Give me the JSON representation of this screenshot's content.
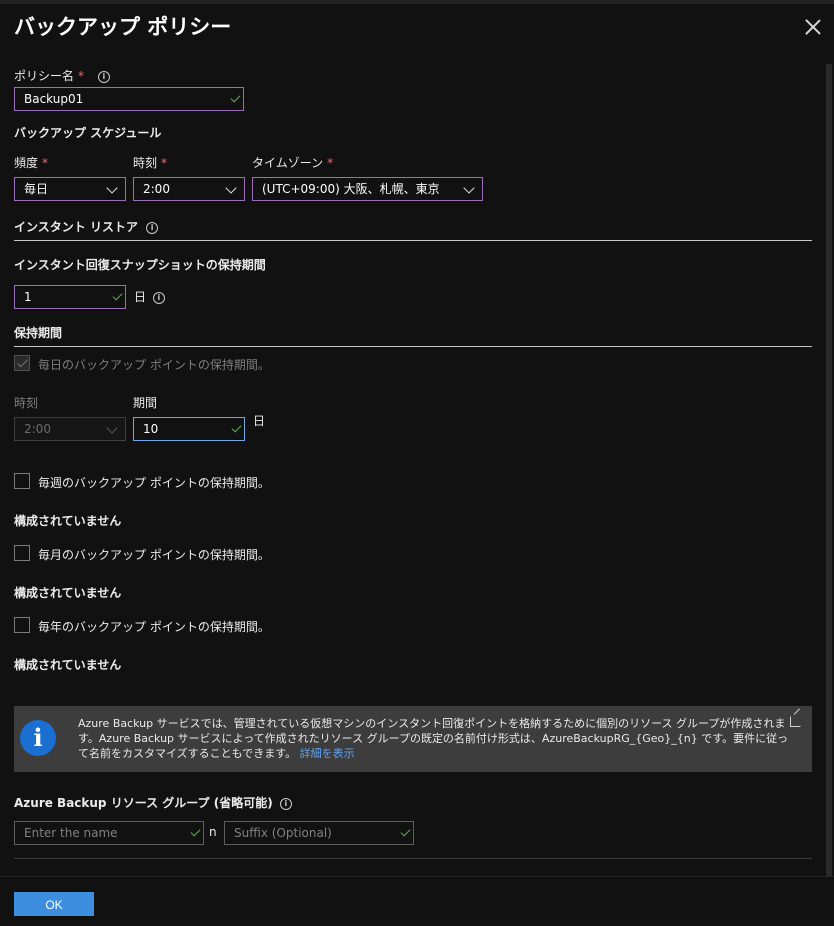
{
  "header": {
    "title": "バックアップ ポリシー"
  },
  "policy_name": {
    "label": "ポリシー名",
    "required": "*",
    "value": "Backup01"
  },
  "schedule": {
    "heading": "バックアップ スケジュール",
    "frequency": {
      "label": "頻度",
      "required": "*",
      "value": "毎日"
    },
    "time": {
      "label": "時刻",
      "required": "*",
      "value": "2:00"
    },
    "timezone": {
      "label": "タイムゾーン",
      "required": "*",
      "value": "(UTC+09:00) 大阪、札幌、東京"
    }
  },
  "instant_restore": {
    "heading": "インスタント リストア",
    "snapshot_label": "インスタント回復スナップショットの保持期間",
    "snapshot_value": "1",
    "unit": "日"
  },
  "retention": {
    "heading": "保持期間",
    "daily": {
      "label": "毎日のバックアップ ポイントの保持期間。",
      "checked": true,
      "time_label": "時刻",
      "time_value": "2:00",
      "duration_label": "期間",
      "duration_value": "10",
      "unit": "日"
    },
    "weekly": {
      "label": "毎週のバックアップ ポイントの保持期間。",
      "checked": false,
      "status": "構成されていません"
    },
    "monthly": {
      "label": "毎月のバックアップ ポイントの保持期間。",
      "checked": false,
      "status": "構成されていません"
    },
    "yearly": {
      "label": "毎年のバックアップ ポイントの保持期間。",
      "checked": false,
      "status": "構成されていません"
    }
  },
  "info_banner": {
    "icon": "info-icon",
    "text": "Azure Backup サービスでは、管理されている仮想マシンのインスタント回復ポイントを格納するために個別のリソース グループが作成されます。Azure Backup サービスによって作成されたリソース グループの既定の名前付け形式は、AzureBackupRG_{Geo}_{n} です。要件に従って名前をカスタマイズすることもできます。",
    "link": "詳細を表示"
  },
  "resource_group": {
    "label": "Azure Backup リソース グループ (省略可能)",
    "name_placeholder": "Enter the name",
    "separator": "n",
    "suffix_placeholder": "Suffix (Optional)"
  },
  "footer": {
    "ok_label": "OK"
  },
  "colors": {
    "accent": "#3e8ee0",
    "field_border": "#9a6fb8",
    "required": "#f06a6a",
    "valid": "#58b54a"
  }
}
